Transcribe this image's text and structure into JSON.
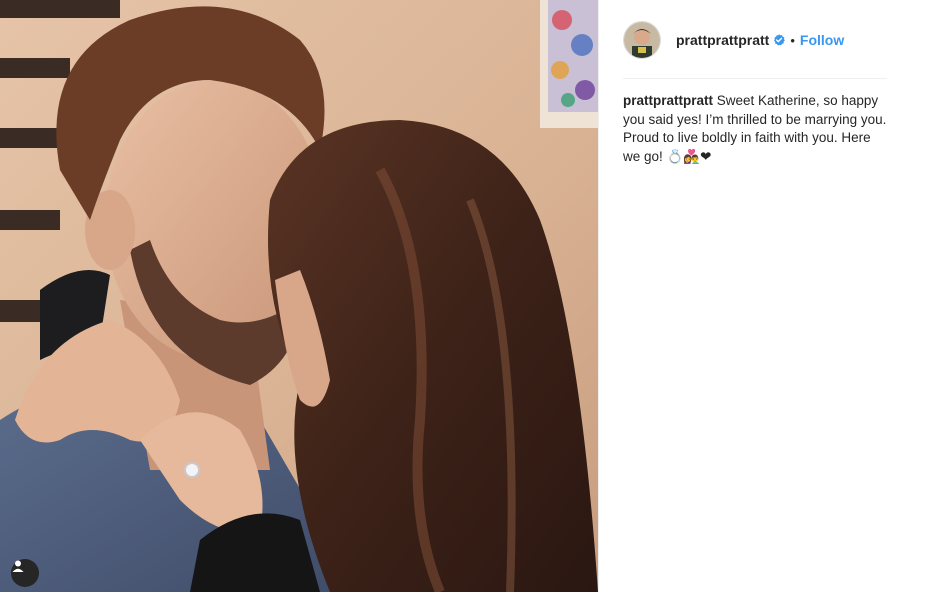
{
  "post": {
    "user": {
      "username": "prattprattpratt",
      "verified_icon": "verified-badge-icon",
      "separator": "•",
      "follow_label": "Follow"
    },
    "caption": {
      "username": "prattprattpratt",
      "text": "Sweet Katherine, so happy you said yes! I’m thrilled to be marrying you. Proud to live boldly in faith with you. Here we go! 💍👩‍❤️‍👨❤"
    },
    "photo": {
      "description_icon": "photo",
      "tag_button_icon": "user-tag-icon"
    },
    "colors": {
      "link": "#3897f0",
      "text": "#262626",
      "divider": "#efefef"
    }
  }
}
